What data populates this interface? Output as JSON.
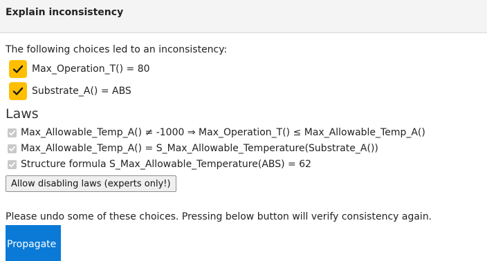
{
  "header": {
    "title": "Explain inconsistency"
  },
  "intro": "The following choices led to an inconsistency:",
  "choices": [
    {
      "label": "Max_Operation_T() = 80",
      "checked": true
    },
    {
      "label": "Substrate_A() = ABS",
      "checked": true
    }
  ],
  "laws": {
    "heading": "Laws",
    "items": [
      {
        "label": "Max_Allowable_Temp_A() ≠ -1000 ⇒ Max_Operation_T() ≤ Max_Allowable_Temp_A()",
        "checked": true
      },
      {
        "label": "Max_Allowable_Temp_A() = S_Max_Allowable_Temperature(Substrate_A())",
        "checked": true
      },
      {
        "label": "Structure formula S_Max_Allowable_Temperature(ABS) = 62",
        "checked": true
      }
    ],
    "disable_button": "Allow disabling laws (experts only!)"
  },
  "undo_text": "Please undo some of these choices. Pressing below button will verify consistency again.",
  "propagate_button": "Propagate",
  "colors": {
    "accent": "#ffbf00",
    "primary_button": "#0a7ad6",
    "disabled_check": "#c9c9c9"
  }
}
